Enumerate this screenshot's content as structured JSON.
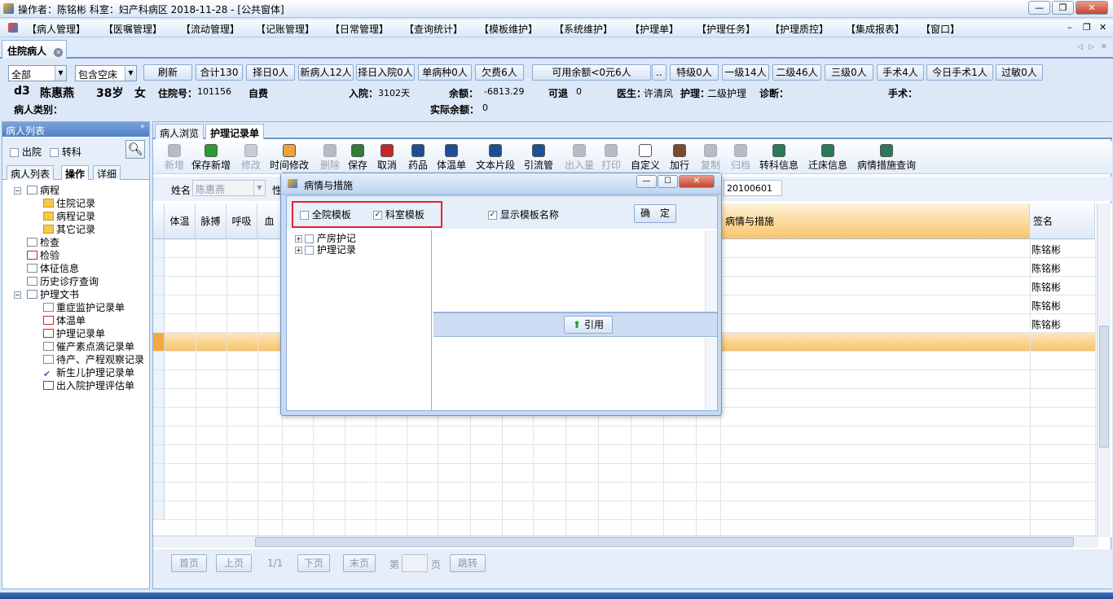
{
  "titlebar": {
    "text": "操作者：陈铭彬  科室：妇产科病区  2018-11-28 - [公共窗体]",
    "min": "—",
    "restore": "❐",
    "close": "✕"
  },
  "menu": [
    "【病人管理】",
    "【医嘱管理】",
    "【流动管理】",
    "【记账管理】",
    "【日常管理】",
    "【查询统计】",
    "【模板维护】",
    "【系统维护】",
    "【护理单】",
    "【护理任务】",
    "【护理质控】",
    "【集成报表】",
    "【窗口】"
  ],
  "doc_tab": {
    "label": "住院病人"
  },
  "filters": {
    "scope": "全部",
    "bed": "包含空床",
    "buttons": [
      "刷新",
      "合计130",
      "择日0人",
      "新病人12人",
      "择日入院0人",
      "单病种0人",
      "欠费6人",
      "可用余额<0元6人",
      "..",
      "特级0人",
      "一级14人",
      "二级46人",
      "三级0人",
      "手术4人",
      "今日手术1人",
      "过敏0人"
    ]
  },
  "patient": {
    "bed": "d3",
    "name": "陈惠燕",
    "age": "38岁",
    "sex": "女",
    "inpatient_no_label": "住院号：",
    "inpatient_no": "101156",
    "pay_type": "自费",
    "admit_label": "入院：",
    "admit_days": "3102天",
    "balance_label": "余额：",
    "balance": "-6813.29",
    "refund_label": "可退",
    "refund": "0",
    "doctor_label": "医生：",
    "doctor": "许清凤",
    "nursing_label": "护理：",
    "nursing": "二级护理",
    "diagnosis_label": "诊断：",
    "surgery_label": "手术：",
    "category_label": "病人类别：",
    "actual_balance_label": "实际余额：",
    "actual_balance": "0"
  },
  "left": {
    "header": "病人列表",
    "pin": "ᵠ",
    "opt_discharge": "出院",
    "opt_transfer": "转科",
    "tabs": [
      "病人列表",
      "操作",
      "详细"
    ],
    "tree": [
      {
        "label": "病程",
        "icon": "doc"
      },
      {
        "label": "住院记录",
        "icon": "folder"
      },
      {
        "label": "病程记录",
        "icon": "folder"
      },
      {
        "label": "其它记录",
        "icon": "folder"
      },
      {
        "label": "检查",
        "icon": "search"
      },
      {
        "label": "检验",
        "icon": "tube"
      },
      {
        "label": "体征信息",
        "icon": "doc"
      },
      {
        "label": "历史诊疗查询",
        "icon": "doc"
      },
      {
        "label": "护理文书",
        "icon": "doc"
      },
      {
        "label": "重症监护记录单",
        "icon": "doc"
      },
      {
        "label": "体温单",
        "icon": "sheet"
      },
      {
        "label": "护理记录单",
        "icon": "sheet"
      },
      {
        "label": "催产素点滴记录单",
        "icon": "doc"
      },
      {
        "label": "待产、产程观察记录",
        "icon": "doc"
      },
      {
        "label": "新生儿护理记录单",
        "icon": "check"
      },
      {
        "label": "出入院护理评估单",
        "icon": "sheet"
      }
    ]
  },
  "right": {
    "tabs": [
      "病人浏览",
      "护理记录单"
    ],
    "toolbar": [
      {
        "label": "新增",
        "enabled": false,
        "color": "#b6bcc4"
      },
      {
        "label": "保存新增",
        "enabled": true,
        "color": "#2e9b2e"
      },
      {
        "label": "修改",
        "enabled": false,
        "color": "#c8ccd2"
      },
      {
        "label": "时间修改",
        "enabled": true,
        "color": "#f0a23a"
      },
      {
        "label": "删除",
        "enabled": false,
        "color": "#b6bcc4"
      },
      {
        "label": "保存",
        "enabled": true,
        "color": "#2e7d32"
      },
      {
        "label": "取消",
        "enabled": true,
        "color": "#c62828"
      },
      {
        "label": "药品",
        "enabled": true,
        "color": "#1e4f95"
      },
      {
        "label": "体温单",
        "enabled": true,
        "color": "#1e4f95"
      },
      {
        "label": "文本片段",
        "enabled": true,
        "color": "#1e4f95"
      },
      {
        "label": "引流管",
        "enabled": true,
        "color": "#1e4f95"
      },
      {
        "label": "出入量",
        "enabled": false,
        "color": "#b6bcc4"
      },
      {
        "label": "打印",
        "enabled": false,
        "color": "#b6bcc4"
      },
      {
        "label": "自定义",
        "enabled": true,
        "color": "#ffffff"
      },
      {
        "label": "加行",
        "enabled": true,
        "color": "#7a4a2a"
      },
      {
        "label": "复制",
        "enabled": false,
        "color": "#b6bcc4"
      },
      {
        "label": "归档",
        "enabled": false,
        "color": "#b6bcc4"
      },
      {
        "label": "转科信息",
        "enabled": true,
        "color": "#2a7a5a"
      },
      {
        "label": "迁床信息",
        "enabled": true,
        "color": "#2a7a5a"
      },
      {
        "label": "病情措施查询",
        "enabled": true,
        "color": "#2a7a5a"
      }
    ],
    "form": {
      "name_label": "姓名",
      "name_value": "陈惠燕",
      "sex_label": "性",
      "date_value": "20100601"
    },
    "grid": {
      "headers": [
        "体温",
        "脉搏",
        "呼吸",
        "血",
        "病情与措施",
        "签名"
      ],
      "signatures": [
        "陈铭彬",
        "陈铭彬",
        "陈铭彬",
        "陈铭彬",
        "陈铭彬"
      ]
    },
    "pager": {
      "first": "首页",
      "prev": "上页",
      "pageinfo": "1/1",
      "next": "下页",
      "last": "末页",
      "page_label_pre": "第",
      "page_label_post": "页",
      "jump": "跳转"
    }
  },
  "dialog": {
    "title": "病情与措施",
    "min": "—",
    "max": "☐",
    "close": "✕",
    "opt_hospital": "全院模板",
    "opt_dept": "科室模板",
    "opt_show_name": "显示模板名称",
    "confirm": "确　定",
    "tree": [
      "产房护记",
      "护理记录"
    ],
    "cite": "引用"
  }
}
